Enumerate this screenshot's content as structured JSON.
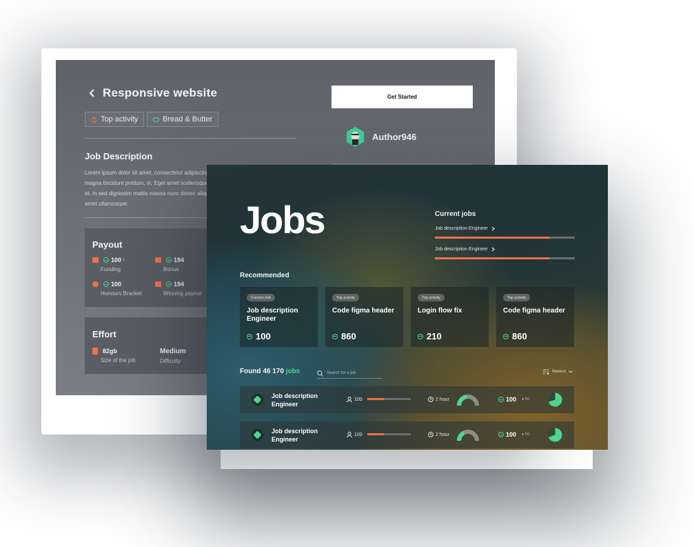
{
  "colors": {
    "accent_orange": "#f07149",
    "accent_green": "#4fd58f"
  },
  "back_window": {
    "title": "Responsive website",
    "chips": [
      {
        "icon": "flame-icon",
        "label": "Top activity"
      },
      {
        "icon": "tag-icon",
        "label": "Bread & Butter"
      }
    ],
    "job_description": {
      "heading": "Job Description",
      "lines": [
        "Lorem ipsum dolor sit amet, consectetur adipiscing",
        "magna tincidunt pretium, in. Eget amet scelerisque e",
        "et, in sed dignissim mattis massa nunc donec aliqu",
        "amet ullamcorper."
      ]
    },
    "payout": {
      "heading": "Payout",
      "items": [
        {
          "icon": "card-icon",
          "value": "100",
          "superscript": "i",
          "label": "Funding"
        },
        {
          "icon": "wallet-icon",
          "value": "194",
          "label": "Bonus"
        },
        {
          "icon": "medal-icon",
          "value": "100",
          "label": "Honours Bracket"
        },
        {
          "icon": "trophy-icon",
          "value": "194",
          "label": "Winning payout"
        }
      ]
    },
    "effort": {
      "heading": "Effort",
      "items": [
        {
          "icon": "file-icon",
          "value": "82gb",
          "label": "Size of the job"
        },
        {
          "value": "Medium",
          "label": "Difficulty"
        }
      ]
    },
    "get_started_label": "Get Started",
    "author_name": "Author946"
  },
  "front_window": {
    "title": "Jobs",
    "current_jobs": {
      "heading": "Current jobs",
      "items": [
        {
          "label": "Job description Engineer",
          "progress": 0.82
        },
        {
          "label": "Job description Engineer",
          "progress": 0.82
        }
      ]
    },
    "recommended": {
      "heading": "Recommended",
      "cards": [
        {
          "tag": "Current Job",
          "name": "Job description Engineer",
          "price": "100"
        },
        {
          "tag": "Top activity",
          "name": "Code  figma header",
          "price": "860"
        },
        {
          "tag": "Top activity",
          "name": "Login flow fix",
          "price": "210"
        },
        {
          "tag": "Top activity",
          "name": "Code  figma header",
          "price": "860"
        }
      ]
    },
    "found": {
      "prefix": "Found 46 170",
      "accent": "jobs"
    },
    "search_placeholder": "Search for a job",
    "sort_label": "Newest",
    "rows": [
      {
        "name": "Job description Engineer",
        "people": "100",
        "people_progress": 0.38,
        "time": "2 hour",
        "price": "100",
        "sub": "50",
        "gauge_fill": 0.45,
        "pie_fill": 0.7
      },
      {
        "name": "Job description Engineer",
        "people": "100",
        "people_progress": 0.38,
        "time": "2 hour",
        "price": "100",
        "sub": "50",
        "gauge_fill": 0.35,
        "pie_fill": 0.7
      }
    ]
  }
}
